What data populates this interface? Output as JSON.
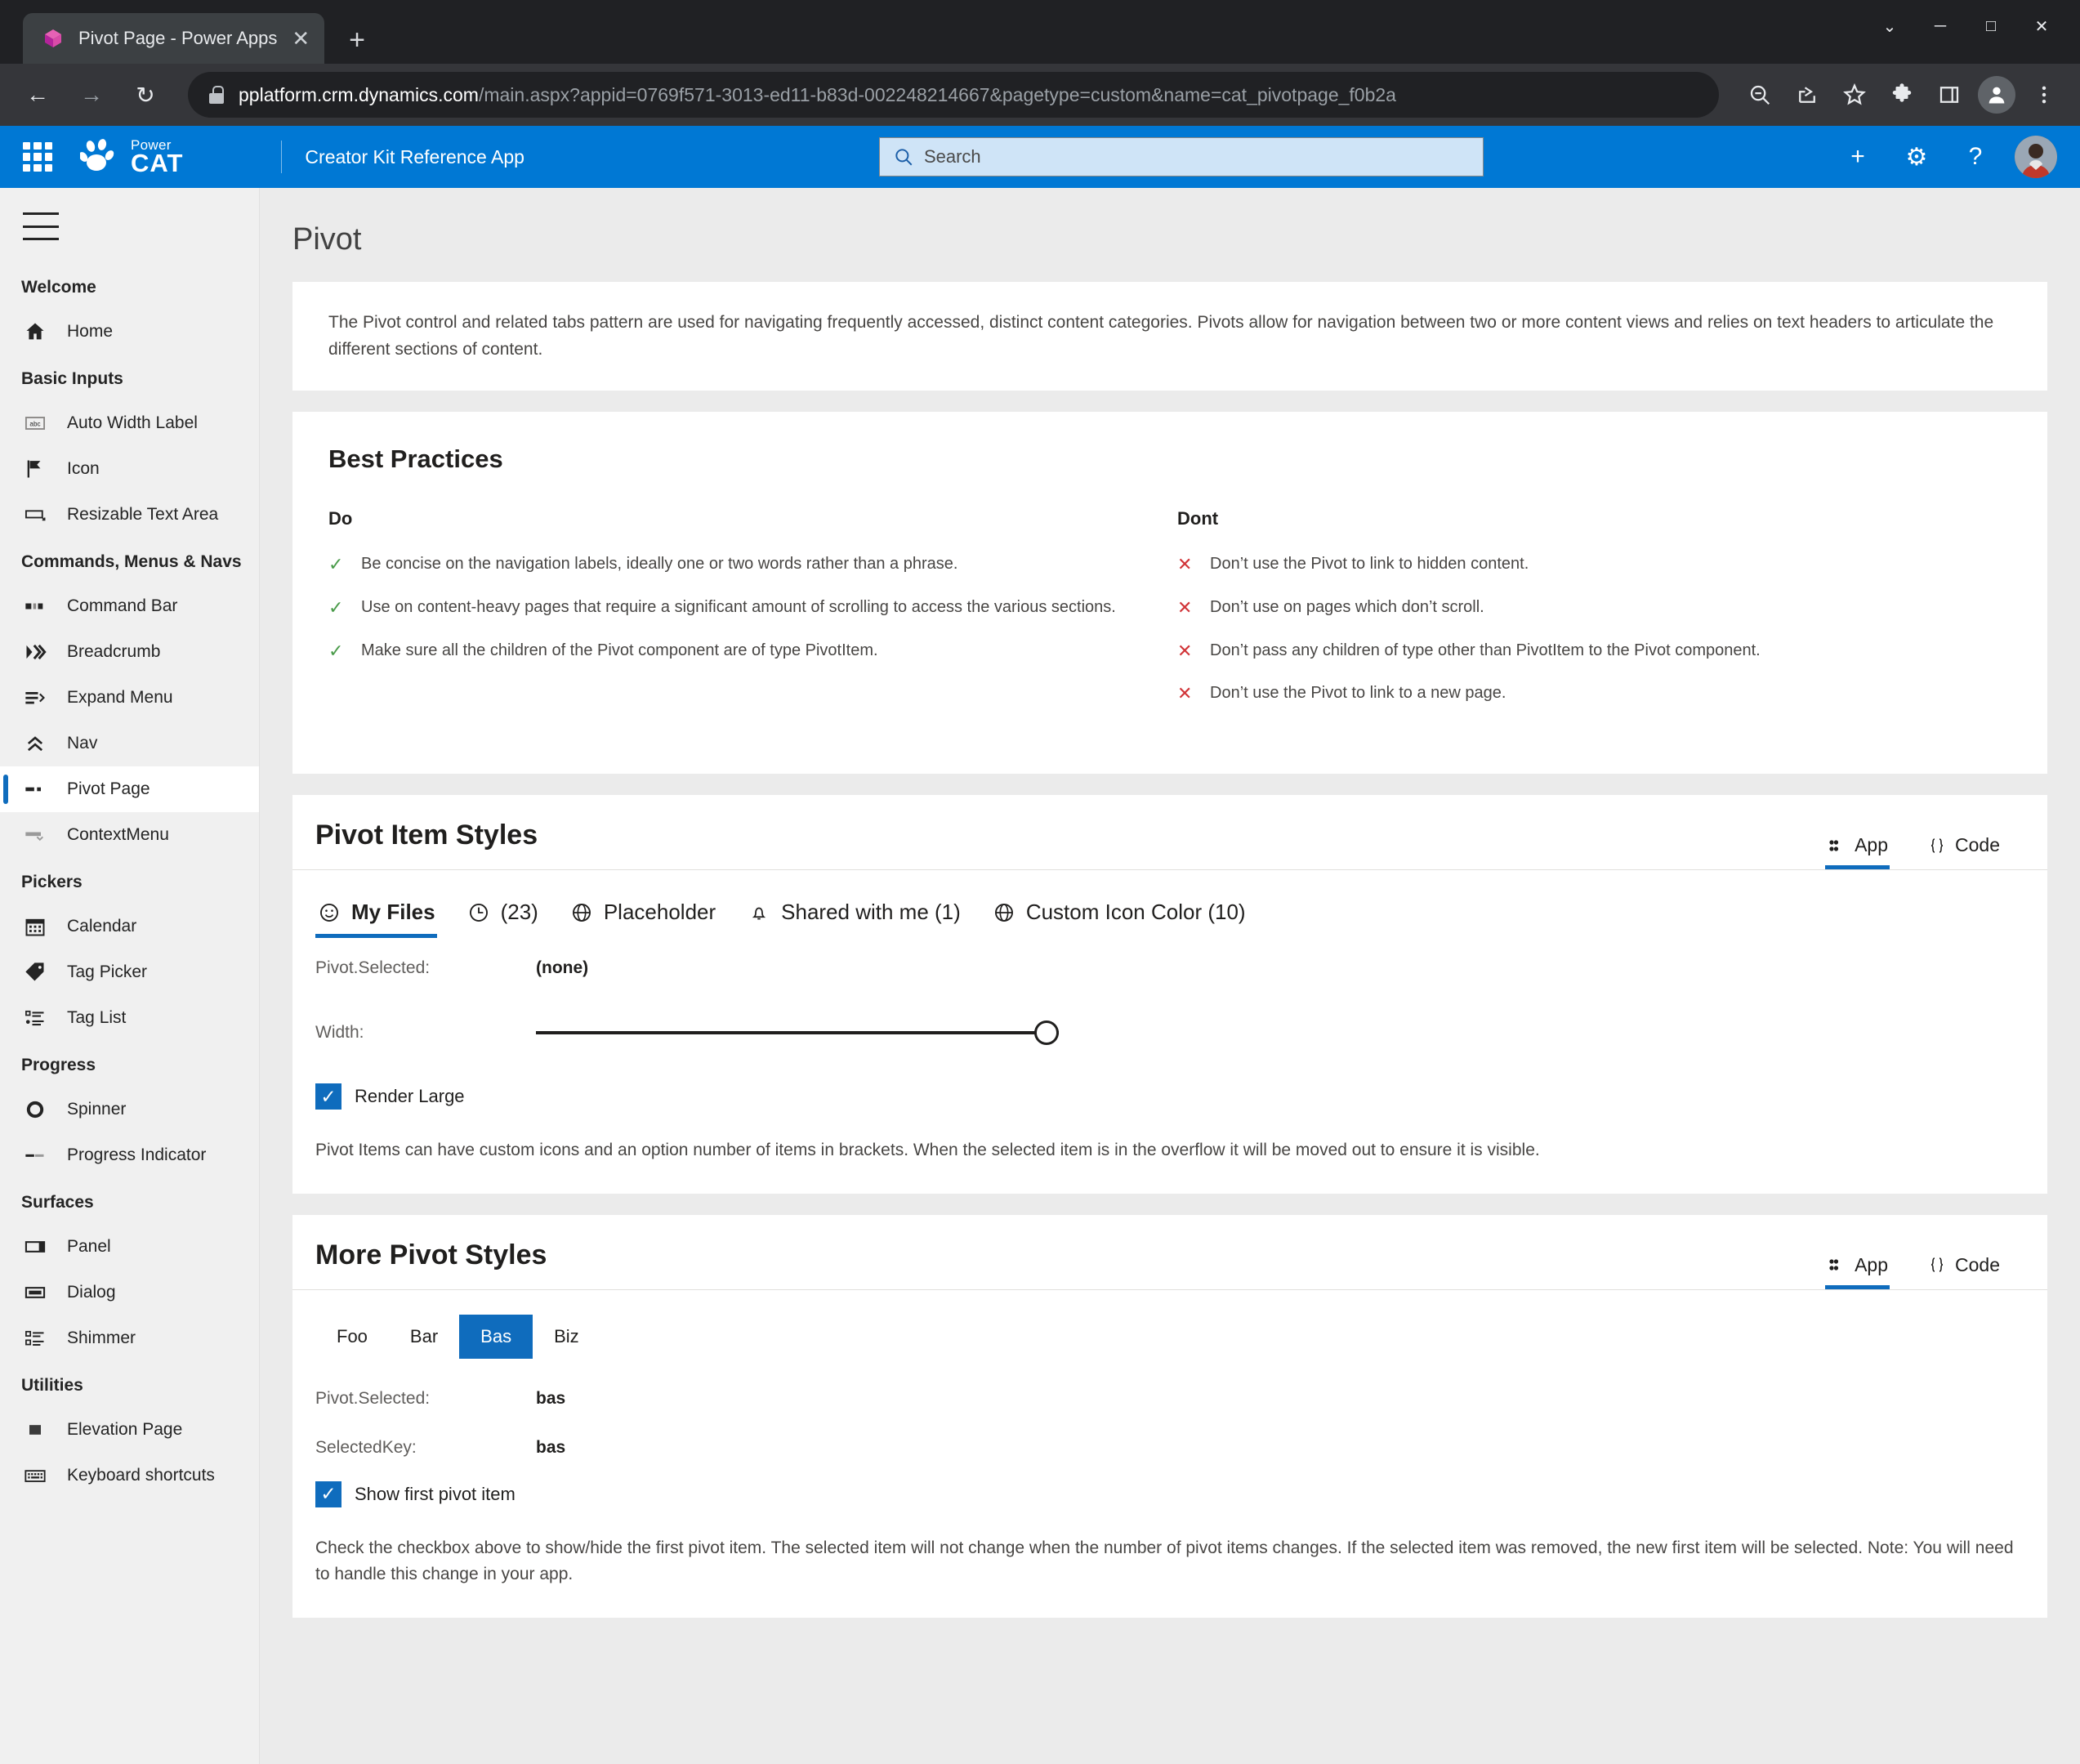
{
  "browser": {
    "tab_title": "Pivot Page - Power Apps",
    "close_glyph": "✕",
    "newtab_glyph": "+",
    "window_minimize": "─",
    "window_maximize": "□",
    "window_close": "✕",
    "window_chevron": "⌄",
    "back_glyph": "←",
    "forward_glyph": "→",
    "reload_glyph": "↻",
    "url_host": "pplatform.crm.dynamics.com",
    "url_path": "/main.aspx?appid=0769f571-3013-ed11-b83d-002248214667&pagetype=custom&name=cat_pivotpage_f0b2a",
    "toolbar_icons": [
      "zoom-out-icon",
      "share-icon",
      "favorite-star-icon",
      "extensions-icon",
      "split-screen-icon",
      "profile-icon",
      "more-menu-icon"
    ]
  },
  "appbar": {
    "waffle": "app-launcher",
    "logo_power": "Power",
    "logo_cat": "CAT",
    "app_name": "Creator Kit Reference App",
    "search_placeholder": "Search",
    "new_glyph": "+",
    "settings_glyph": "⚙",
    "help_glyph": "?"
  },
  "sidebar": {
    "groups": [
      {
        "label": "Welcome",
        "items": [
          {
            "label": "Home",
            "icon": "home-icon",
            "selected": false
          }
        ]
      },
      {
        "label": "Basic Inputs",
        "items": [
          {
            "label": "Auto Width Label",
            "icon": "label-abc-icon",
            "selected": false
          },
          {
            "label": "Icon",
            "icon": "flag-icon",
            "selected": false
          },
          {
            "label": "Resizable Text Area",
            "icon": "textarea-icon",
            "selected": false
          }
        ]
      },
      {
        "label": "Commands, Menus & Navs",
        "items": [
          {
            "label": "Command Bar",
            "icon": "command-bar-icon",
            "selected": false
          },
          {
            "label": "Breadcrumb",
            "icon": "breadcrumb-icon",
            "selected": false
          },
          {
            "label": "Expand Menu",
            "icon": "expand-menu-icon",
            "selected": false
          },
          {
            "label": "Nav",
            "icon": "double-chevron-up-icon",
            "selected": false
          },
          {
            "label": "Pivot Page",
            "icon": "pivot-icon",
            "selected": true
          },
          {
            "label": "ContextMenu",
            "icon": "context-menu-icon",
            "selected": false
          }
        ]
      },
      {
        "label": "Pickers",
        "items": [
          {
            "label": "Calendar",
            "icon": "calendar-icon",
            "selected": false
          },
          {
            "label": "Tag Picker",
            "icon": "tag-icon",
            "selected": false
          },
          {
            "label": "Tag List",
            "icon": "list-icon",
            "selected": false
          }
        ]
      },
      {
        "label": "Progress",
        "items": [
          {
            "label": "Spinner",
            "icon": "spinner-icon",
            "selected": false
          },
          {
            "label": "Progress Indicator",
            "icon": "progress-bar-icon",
            "selected": false
          }
        ]
      },
      {
        "label": "Surfaces",
        "items": [
          {
            "label": "Panel",
            "icon": "panel-icon",
            "selected": false
          },
          {
            "label": "Dialog",
            "icon": "dialog-icon",
            "selected": false
          },
          {
            "label": "Shimmer",
            "icon": "shimmer-icon",
            "selected": false
          }
        ]
      },
      {
        "label": "Utilities",
        "items": [
          {
            "label": "Elevation Page",
            "icon": "elevation-icon",
            "selected": false
          },
          {
            "label": "Keyboard shortcuts",
            "icon": "keyboard-icon",
            "selected": false
          }
        ]
      }
    ]
  },
  "page": {
    "title": "Pivot",
    "intro": "The Pivot control and related tabs pattern are used for navigating frequently accessed, distinct content categories. Pivots allow for navigation between two or more content views and relies on text headers to articulate the different sections of content."
  },
  "best_practices": {
    "title": "Best Practices",
    "do_heading": "Do",
    "dont_heading": "Dont",
    "do_mark": "✓",
    "dont_mark": "✕",
    "do": [
      "Be concise on the navigation labels, ideally one or two words rather than a phrase.",
      "Use on content-heavy pages that require a significant amount of scrolling to access the various sections.",
      "Make sure all the children of the Pivot component are of type PivotItem."
    ],
    "dont": [
      "Don’t use the Pivot to link to hidden content.",
      "Don’t use on pages which don’t scroll.",
      "Don’t pass any children of type other than PivotItem to the Pivot component.",
      "Don’t use the Pivot to link to a new page."
    ]
  },
  "section_one": {
    "title": "Pivot Item Styles",
    "app_tab": "App",
    "code_tab": "Code",
    "app_icon": "app-icon",
    "code_icon": "code-braces-icon",
    "tabs": [
      {
        "label": "My Files",
        "icon": "emoji-icon",
        "active": true
      },
      {
        "label": "(23)",
        "icon": "clock-icon",
        "active": false
      },
      {
        "label": "Placeholder",
        "icon": "globe-icon",
        "active": false
      },
      {
        "label": "Shared with me (1)",
        "icon": "bell-icon",
        "active": false
      },
      {
        "label": "Custom Icon Color (10)",
        "icon": "globe-icon",
        "active": false
      }
    ],
    "selected_key": "Pivot.Selected:",
    "selected_value": "(none)",
    "width_key": "Width:",
    "checkbox_label": "Render Large",
    "checkbox_checked": true,
    "check_glyph": "✓",
    "note": "Pivot Items can have custom icons and an option number of items in brackets. When the selected item is in the overflow it will be moved out to ensure it is visible."
  },
  "section_two": {
    "title": "More Pivot Styles",
    "app_tab": "App",
    "code_tab": "Code",
    "app_icon": "app-icon",
    "code_icon": "code-braces-icon",
    "tabs": [
      {
        "label": "Foo",
        "active": false
      },
      {
        "label": "Bar",
        "active": false
      },
      {
        "label": "Bas",
        "active": true
      },
      {
        "label": "Biz",
        "active": false
      }
    ],
    "selected_key": "Pivot.Selected:",
    "selected_value": "bas",
    "selectedkey_key": "SelectedKey:",
    "selectedkey_value": "bas",
    "checkbox_label": "Show first pivot item",
    "checkbox_checked": true,
    "check_glyph": "✓",
    "note": "Check the checkbox above to show/hide the first pivot item. The selected item will not change when the number of pivot items changes. If the selected item was removed, the new first item will be selected. Note: You will need to handle this change in your app."
  },
  "colors": {
    "brand_blue": "#0078d4",
    "accent_blue": "#0f6cbd",
    "do_green": "#4a9b4a",
    "dont_red": "#d13438"
  }
}
